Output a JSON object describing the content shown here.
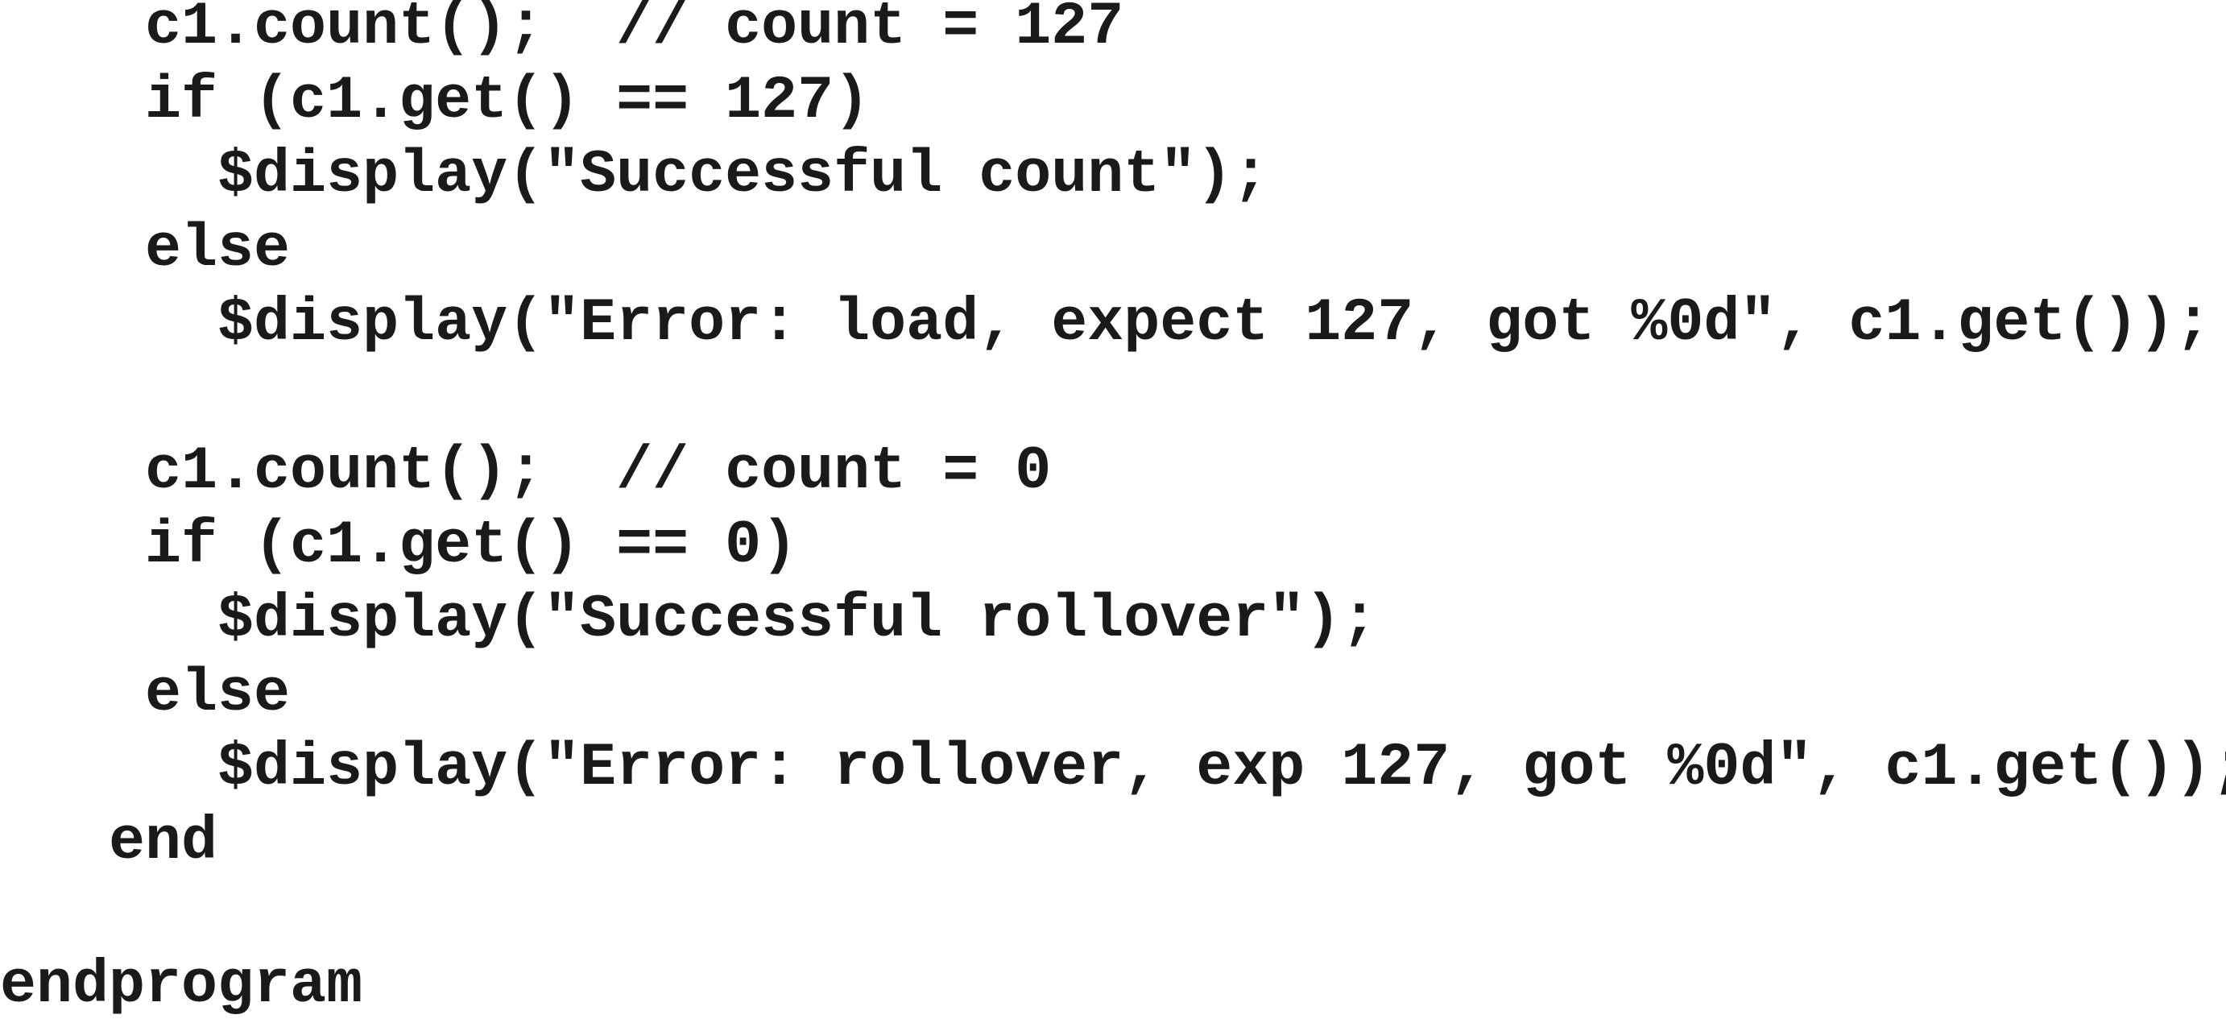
{
  "code": {
    "lines": [
      "    c1.count();  // count = 127",
      "    if (c1.get() == 127)",
      "      $display(\"Successful count\");",
      "    else",
      "      $display(\"Error: load, expect 127, got %0d\", c1.get());",
      "    c1.count();  // count = 0",
      "    if (c1.get() == 0)",
      "      $display(\"Successful rollover\");",
      "    else",
      "      $display(\"Error: rollover, exp 127, got %0d\", c1.get());",
      "   end",
      "endprogram"
    ]
  }
}
